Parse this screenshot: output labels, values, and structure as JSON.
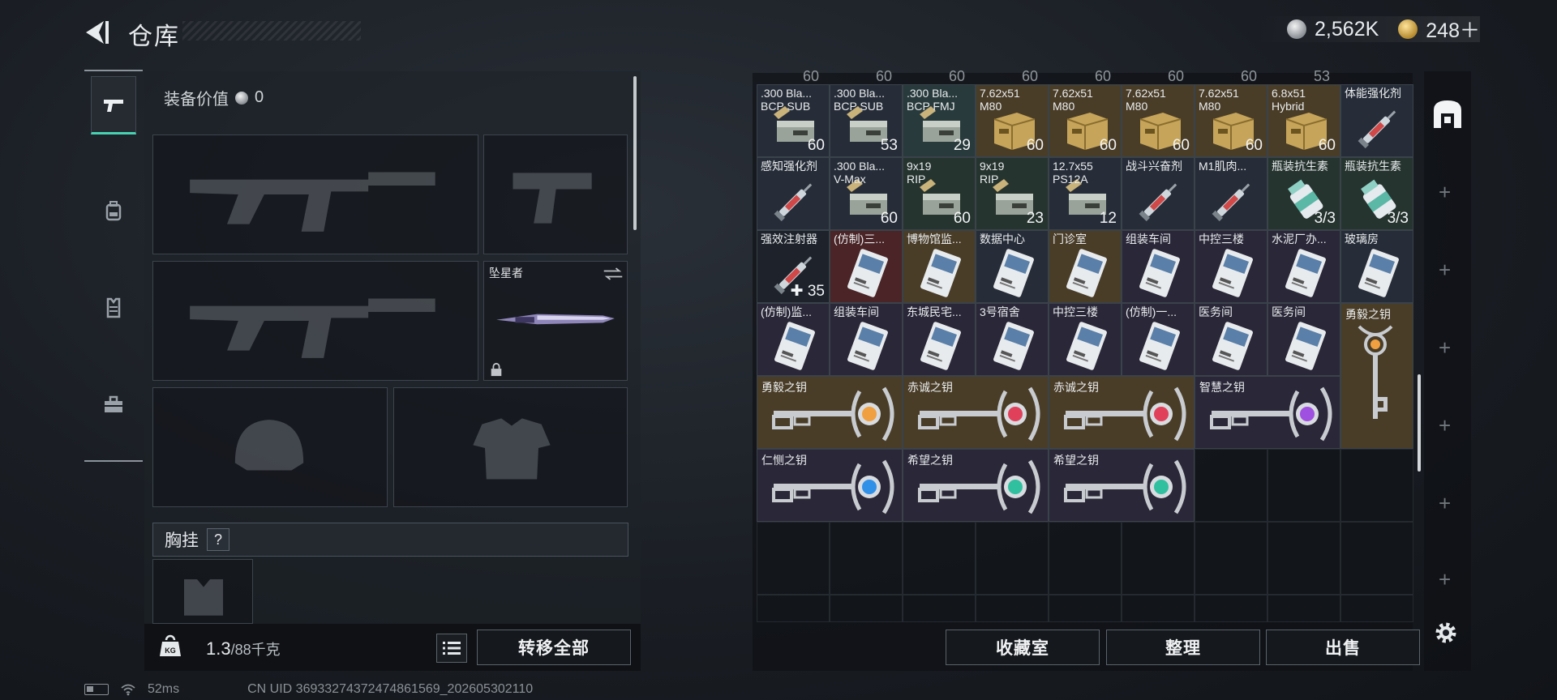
{
  "header": {
    "title": "仓库",
    "back_icon": "back-arrow-icon"
  },
  "currency": {
    "silver": "2,562K",
    "gold": "248＋"
  },
  "left_tabs": [
    {
      "icon": "pistol-icon",
      "active": true
    },
    {
      "icon": "backpack-icon",
      "active": false
    },
    {
      "icon": "vest-icon",
      "active": false
    },
    {
      "icon": "toolbox-icon",
      "active": false
    }
  ],
  "equipment": {
    "value_label": "装备价值",
    "value": "0",
    "melee_name": "坠星者",
    "rig_label": "胸挂",
    "rig_help": "?"
  },
  "weight": {
    "current": "1.3",
    "max": "/88千克"
  },
  "buttons": {
    "transfer_all": "转移全部",
    "collection": "收藏室",
    "sort": "整理",
    "sell": "出售"
  },
  "status": {
    "ping": "52ms",
    "uid": "CN UID 36933274372474861569_202605302110"
  },
  "top_row_values": [
    "60",
    "60",
    "60",
    "60",
    "60",
    "60",
    "60",
    "53"
  ],
  "inventory_rows": [
    [
      {
        "name": ".300 Bla...",
        "sub": "BCP SUB",
        "qty": "60",
        "bg": "slate",
        "kind": "ammo"
      },
      {
        "name": ".300 Bla...",
        "sub": "BCP SUB",
        "qty": "53",
        "bg": "slate",
        "kind": "ammo"
      },
      {
        "name": ".300 Bla...",
        "sub": "BCP FMJ",
        "qty": "29",
        "bg": "teal",
        "kind": "ammo"
      },
      {
        "name": "7.62x51",
        "sub": "M80",
        "qty": "60",
        "bg": "gold",
        "kind": "box"
      },
      {
        "name": "7.62x51",
        "sub": "M80",
        "qty": "60",
        "bg": "gold",
        "kind": "box"
      },
      {
        "name": "7.62x51",
        "sub": "M80",
        "qty": "60",
        "bg": "gold",
        "kind": "box"
      },
      {
        "name": "7.62x51",
        "sub": "M80",
        "qty": "60",
        "bg": "gold",
        "kind": "box"
      },
      {
        "name": "6.8x51",
        "sub": "Hybrid",
        "qty": "60",
        "bg": "gold",
        "kind": "box"
      },
      {
        "name": "体能强化剂",
        "sub": "",
        "qty": "",
        "bg": "slate",
        "kind": "syringe"
      }
    ],
    [
      {
        "name": "感知强化剂",
        "sub": "",
        "qty": "",
        "bg": "slate",
        "kind": "syringe"
      },
      {
        "name": ".300 Bla...",
        "sub": "V-Max",
        "qty": "60",
        "bg": "slate",
        "kind": "ammo"
      },
      {
        "name": "9x19",
        "sub": "RIP",
        "qty": "60",
        "bg": "green",
        "kind": "ammo"
      },
      {
        "name": "9x19",
        "sub": "RIP",
        "qty": "23",
        "bg": "green",
        "kind": "ammo"
      },
      {
        "name": "12.7x55",
        "sub": "PS12A",
        "qty": "12",
        "bg": "slate",
        "kind": "ammo"
      },
      {
        "name": "战斗兴奋剂",
        "sub": "",
        "qty": "",
        "bg": "slate",
        "kind": "syringe"
      },
      {
        "name": "M1肌肉...",
        "sub": "",
        "qty": "",
        "bg": "slate",
        "kind": "syringe"
      },
      {
        "name": "瓶装抗生素",
        "sub": "",
        "qty": "3/3",
        "bg": "green",
        "kind": "bottle"
      },
      {
        "name": "瓶装抗生素",
        "sub": "",
        "qty": "3/3",
        "bg": "green",
        "kind": "bottle"
      }
    ],
    [
      {
        "name": "强效注射器",
        "sub": "",
        "qty": "✚ 35",
        "bg": "dark",
        "kind": "syringe"
      },
      {
        "name": "(仿制)三...",
        "sub": "",
        "qty": "",
        "bg": "red",
        "kind": "card"
      },
      {
        "name": "博物馆监...",
        "sub": "",
        "qty": "",
        "bg": "gold",
        "kind": "card"
      },
      {
        "name": "数据中心",
        "sub": "",
        "qty": "",
        "bg": "slate",
        "kind": "card"
      },
      {
        "name": "门诊室",
        "sub": "",
        "qty": "",
        "bg": "gold",
        "kind": "card"
      },
      {
        "name": "组装车间",
        "sub": "",
        "qty": "",
        "bg": "purple",
        "kind": "card"
      },
      {
        "name": "中控三楼",
        "sub": "",
        "qty": "",
        "bg": "purple",
        "kind": "card"
      },
      {
        "name": "水泥厂办...",
        "sub": "",
        "qty": "",
        "bg": "purple",
        "kind": "card"
      },
      {
        "name": "玻璃房",
        "sub": "",
        "qty": "",
        "bg": "slate",
        "kind": "card"
      }
    ],
    [
      {
        "name": "(仿制)监...",
        "sub": "",
        "qty": "",
        "bg": "purple",
        "kind": "card"
      },
      {
        "name": "组装车间",
        "sub": "",
        "qty": "",
        "bg": "purple",
        "kind": "card"
      },
      {
        "name": "东城民宅...",
        "sub": "",
        "qty": "",
        "bg": "purple",
        "kind": "card"
      },
      {
        "name": "3号宿舍",
        "sub": "",
        "qty": "",
        "bg": "purple",
        "kind": "card"
      },
      {
        "name": "中控三楼",
        "sub": "",
        "qty": "",
        "bg": "purple",
        "kind": "card"
      },
      {
        "name": "(仿制)一...",
        "sub": "",
        "qty": "",
        "bg": "purple",
        "kind": "card"
      },
      {
        "name": "医务间",
        "sub": "",
        "qty": "",
        "bg": "purple",
        "kind": "card"
      },
      {
        "name": "医务间",
        "sub": "",
        "qty": "",
        "bg": "purple",
        "kind": "card"
      }
    ]
  ],
  "tall_key": {
    "name": "勇毅之钥",
    "gem": "#f0a040"
  },
  "keys": [
    {
      "name": "勇毅之钥",
      "gem": "#f0a040",
      "bg": "gold"
    },
    {
      "name": "赤诚之钥",
      "gem": "#e0405a",
      "bg": "gold"
    },
    {
      "name": "赤诚之钥",
      "gem": "#e0405a",
      "bg": "gold"
    },
    {
      "name": "智慧之钥",
      "gem": "#a050e0",
      "bg": "purple"
    },
    {
      "name": "仁恻之钥",
      "gem": "#3090e8",
      "bg": "purple"
    },
    {
      "name": "希望之钥",
      "gem": "#30c0a0",
      "bg": "purple"
    },
    {
      "name": "希望之钥",
      "gem": "#30c0a0",
      "bg": "purple"
    }
  ]
}
